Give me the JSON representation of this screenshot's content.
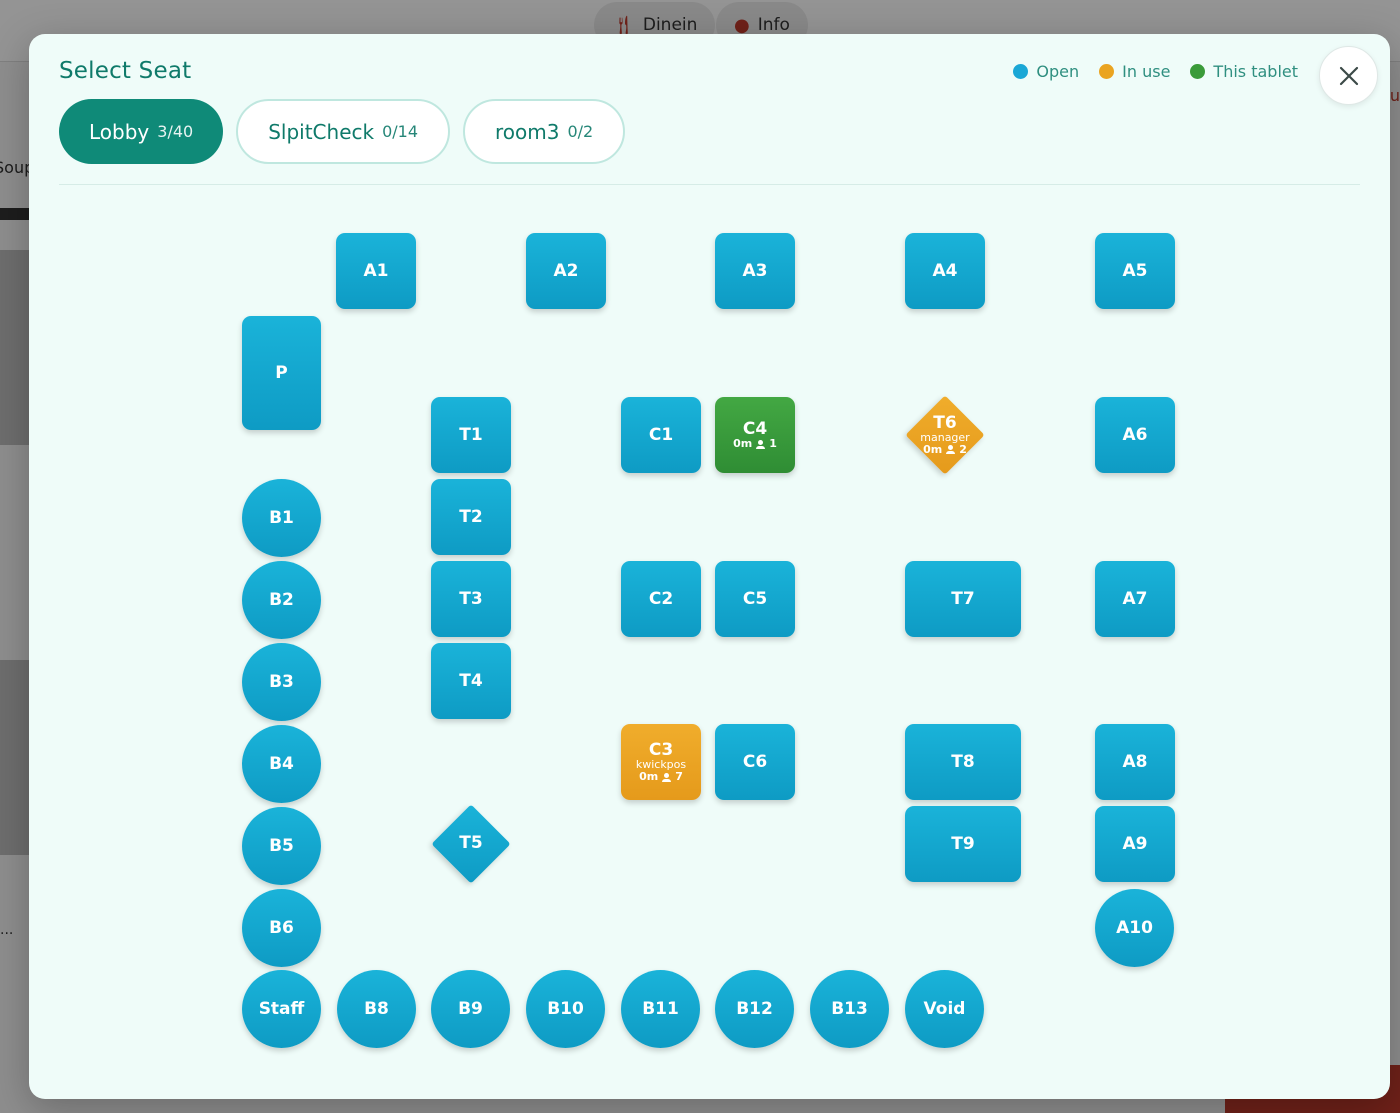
{
  "background": {
    "tabs": [
      {
        "label": "Dinein",
        "icon": "fork-knife-icon"
      },
      {
        "label": "Info",
        "icon": "user-icon"
      }
    ],
    "left_text": "Soup",
    "left_dots": "...",
    "right_text": "u"
  },
  "modal": {
    "title": "Select Seat",
    "close_icon": "close-icon"
  },
  "legend": [
    {
      "label": "Open",
      "color": "#1aa7d6"
    },
    {
      "label": "In use",
      "color": "#eaa421"
    },
    {
      "label": "This tablet",
      "color": "#3a9b3a"
    }
  ],
  "rooms": [
    {
      "name": "Lobby",
      "count": "3/40",
      "active": true
    },
    {
      "name": "SlpitCheck",
      "count": "0/14",
      "active": false
    },
    {
      "name": "room3",
      "count": "0/2",
      "active": false
    }
  ],
  "seats": [
    {
      "label": "A1",
      "shape": "rect",
      "status": "open"
    },
    {
      "label": "A2",
      "shape": "rect",
      "status": "open"
    },
    {
      "label": "A3",
      "shape": "rect",
      "status": "open"
    },
    {
      "label": "A4",
      "shape": "rect",
      "status": "open"
    },
    {
      "label": "A5",
      "shape": "rect",
      "status": "open"
    },
    {
      "label": "P",
      "shape": "rect",
      "status": "open"
    },
    {
      "label": "T1",
      "shape": "rect",
      "status": "open"
    },
    {
      "label": "C1",
      "shape": "rect",
      "status": "open"
    },
    {
      "label": "C4",
      "shape": "rect",
      "status": "tablet",
      "time": "0m",
      "guests": "1"
    },
    {
      "label": "T6",
      "shape": "diamond",
      "status": "inuse",
      "user": "manager",
      "time": "0m",
      "guests": "2"
    },
    {
      "label": "A6",
      "shape": "rect",
      "status": "open"
    },
    {
      "label": "B1",
      "shape": "circle",
      "status": "open"
    },
    {
      "label": "T2",
      "shape": "rect",
      "status": "open"
    },
    {
      "label": "B2",
      "shape": "circle",
      "status": "open"
    },
    {
      "label": "T3",
      "shape": "rect",
      "status": "open"
    },
    {
      "label": "C2",
      "shape": "rect",
      "status": "open"
    },
    {
      "label": "C5",
      "shape": "rect",
      "status": "open"
    },
    {
      "label": "T7",
      "shape": "rect",
      "status": "open"
    },
    {
      "label": "A7",
      "shape": "rect",
      "status": "open"
    },
    {
      "label": "B3",
      "shape": "circle",
      "status": "open"
    },
    {
      "label": "T4",
      "shape": "rect",
      "status": "open"
    },
    {
      "label": "B4",
      "shape": "circle",
      "status": "open"
    },
    {
      "label": "C3",
      "shape": "rect",
      "status": "inuse",
      "user": "kwickpos",
      "time": "0m",
      "guests": "7"
    },
    {
      "label": "C6",
      "shape": "rect",
      "status": "open"
    },
    {
      "label": "T8",
      "shape": "rect",
      "status": "open"
    },
    {
      "label": "A8",
      "shape": "rect",
      "status": "open"
    },
    {
      "label": "B5",
      "shape": "circle",
      "status": "open"
    },
    {
      "label": "T5",
      "shape": "diamond",
      "status": "open"
    },
    {
      "label": "T9",
      "shape": "rect",
      "status": "open"
    },
    {
      "label": "A9",
      "shape": "rect",
      "status": "open"
    },
    {
      "label": "B6",
      "shape": "circle",
      "status": "open"
    },
    {
      "label": "A10",
      "shape": "circle",
      "status": "open"
    },
    {
      "label": "Staff",
      "shape": "circle",
      "status": "open"
    },
    {
      "label": "B8",
      "shape": "circle",
      "status": "open"
    },
    {
      "label": "B9",
      "shape": "circle",
      "status": "open"
    },
    {
      "label": "B10",
      "shape": "circle",
      "status": "open"
    },
    {
      "label": "B11",
      "shape": "circle",
      "status": "open"
    },
    {
      "label": "B12",
      "shape": "circle",
      "status": "open"
    },
    {
      "label": "B13",
      "shape": "circle",
      "status": "open"
    },
    {
      "label": "Void",
      "shape": "circle",
      "status": "open"
    }
  ]
}
